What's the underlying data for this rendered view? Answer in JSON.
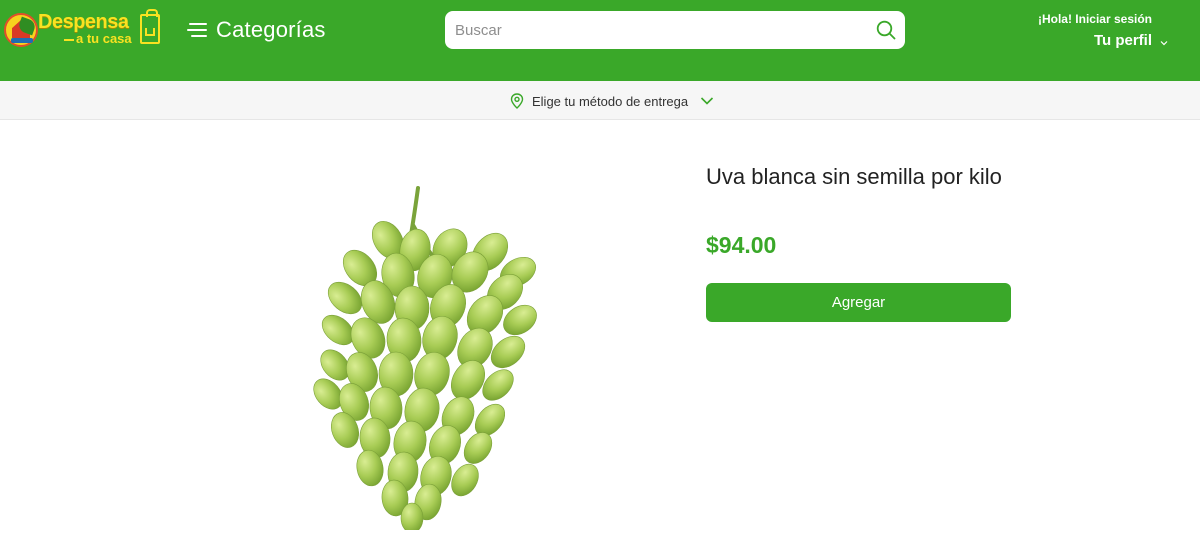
{
  "header": {
    "logo": {
      "title": "Despensa",
      "subtitle": "a tu casa"
    },
    "categories_label": "Categorías",
    "search": {
      "placeholder": "Buscar",
      "value": ""
    },
    "account": {
      "greeting": "¡Hola! Iniciar sesión",
      "profile_label": "Tu perfil"
    }
  },
  "delivery": {
    "label": "Elige tu método de entrega"
  },
  "product": {
    "name": "Uva blanca sin semilla por kilo",
    "price": "$94.00",
    "add_label": "Agregar"
  },
  "colors": {
    "brand_green": "#3aa829",
    "logo_yellow": "#f9e221",
    "delivery_bar": "#f6f6f6"
  },
  "icons": [
    "logo-icon",
    "menu-icon",
    "search-icon",
    "chevron-down-icon",
    "location-pin-icon"
  ]
}
